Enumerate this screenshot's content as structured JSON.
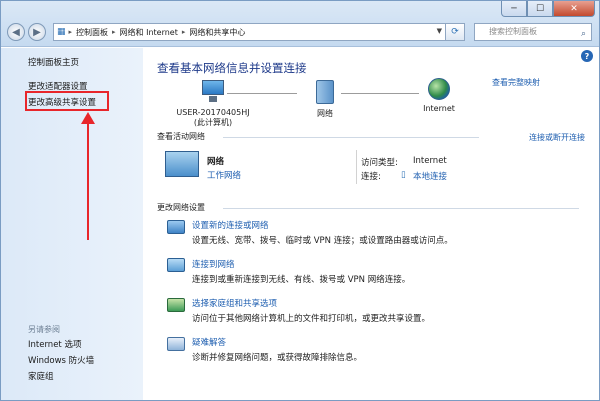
{
  "addressbar": {
    "crumbs": [
      "控制面板",
      "网络和 Internet",
      "网络和共享中心"
    ],
    "search_placeholder": "搜索控制面板"
  },
  "window_controls": {
    "minimize": "─",
    "maximize": "☐",
    "close": "✕"
  },
  "sidebar": {
    "items": [
      {
        "label": "控制面板主页"
      },
      {
        "label": "更改适配器设置"
      },
      {
        "label": "更改高级共享设置"
      }
    ],
    "see_also_label": "另请参阅",
    "see_also": [
      {
        "label": "Internet 选项"
      },
      {
        "label": "Windows 防火墙"
      },
      {
        "label": "家庭组"
      }
    ]
  },
  "main": {
    "title": "查看基本网络信息并设置连接",
    "full_map_link": "查看完整映射",
    "map": {
      "computer_name": "USER-20170405HJ",
      "computer_sub": "(此计算机)",
      "network_label": "网络",
      "internet_label": "Internet"
    },
    "active_networks": {
      "heading": "查看活动网络",
      "connect_link": "连接或断开连接",
      "network_name": "网络",
      "network_type": "工作网络",
      "access_type_label": "访问类型:",
      "access_type_value": "Internet",
      "connections_label": "连接:",
      "connections_value": "本地连接"
    },
    "change_settings": {
      "heading": "更改网络设置",
      "tasks": [
        {
          "title": "设置新的连接或网络",
          "desc": "设置无线、宽带、拨号、临时或 VPN 连接；或设置路由器或访问点。"
        },
        {
          "title": "连接到网络",
          "desc": "连接到或重新连接到无线、有线、拨号或 VPN 网络连接。"
        },
        {
          "title": "选择家庭组和共享选项",
          "desc": "访问位于其他网络计算机上的文件和打印机，或更改共享设置。"
        },
        {
          "title": "疑难解答",
          "desc": "诊断并修复网络问题，或获得故障排除信息。"
        }
      ]
    }
  }
}
